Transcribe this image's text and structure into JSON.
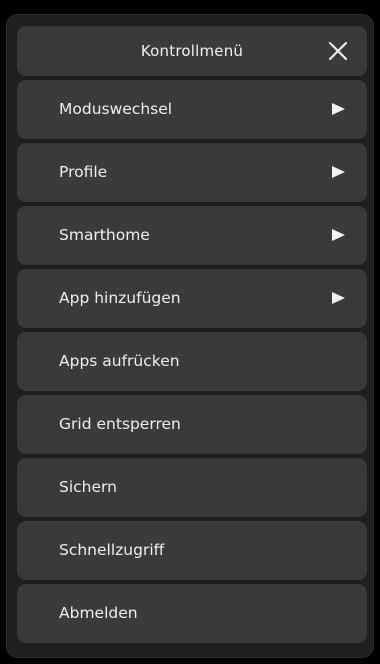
{
  "menu": {
    "title": "Kontrollmenü",
    "close_icon": "close-icon",
    "items": [
      {
        "key": "moduswechsel",
        "label": "Moduswechsel",
        "has_submenu": true
      },
      {
        "key": "profile",
        "label": "Profile",
        "has_submenu": true
      },
      {
        "key": "smarthome",
        "label": "Smarthome",
        "has_submenu": true
      },
      {
        "key": "app-hinzufuegen",
        "label": "App hinzufügen",
        "has_submenu": true
      },
      {
        "key": "apps-aufruecken",
        "label": "Apps aufrücken",
        "has_submenu": false
      },
      {
        "key": "grid-entsperren",
        "label": "Grid entsperren",
        "has_submenu": false
      },
      {
        "key": "sichern",
        "label": "Sichern",
        "has_submenu": false
      },
      {
        "key": "schnellzugriff",
        "label": "Schnellzugriff",
        "has_submenu": false
      },
      {
        "key": "abmelden",
        "label": "Abmelden",
        "has_submenu": false
      }
    ]
  },
  "colors": {
    "background": "#000000",
    "panel": "#1f1f1f",
    "item": "#3a3a3a",
    "text": "#f0f0f0"
  }
}
